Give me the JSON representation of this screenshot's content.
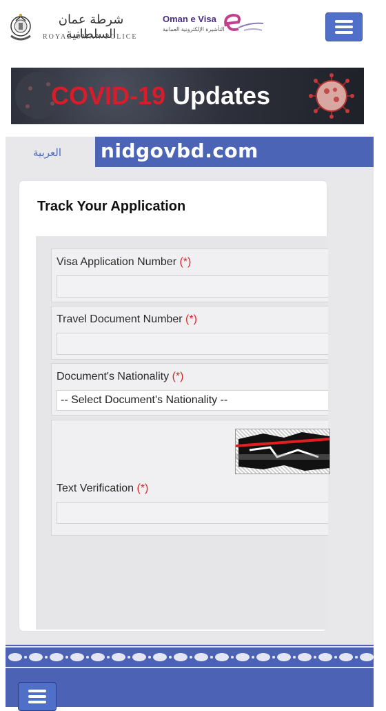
{
  "header": {
    "rop_arabic": "شرطة عمان السلطانية",
    "rop_english": "ROYAL OMAN POLICE",
    "evisa_title": "Oman e Visa",
    "evisa_sub": "التأشيرة الإلكترونية العمانية"
  },
  "banner": {
    "covid_red": "COVID-19",
    "covid_white": " Updates"
  },
  "lang": {
    "arabic_link": "العربية"
  },
  "watermark": "nidgovbd.com",
  "form": {
    "title": "Track Your Application",
    "visa_app_label": "Visa Application Number ",
    "travel_doc_label": "Travel Document Number ",
    "nationality_label": "Document's Nationality ",
    "nationality_selected": "-- Select Document's Nationality --",
    "text_verif_label": "Text Verification ",
    "req_mark": "(*)"
  },
  "colors": {
    "accent": "#4b64b6",
    "required": "#d9262b",
    "covid_red": "#d71c2a"
  },
  "icons": [
    "menu-icon",
    "rop-emblem-icon",
    "evisa-logo-icon",
    "virus-icon"
  ]
}
